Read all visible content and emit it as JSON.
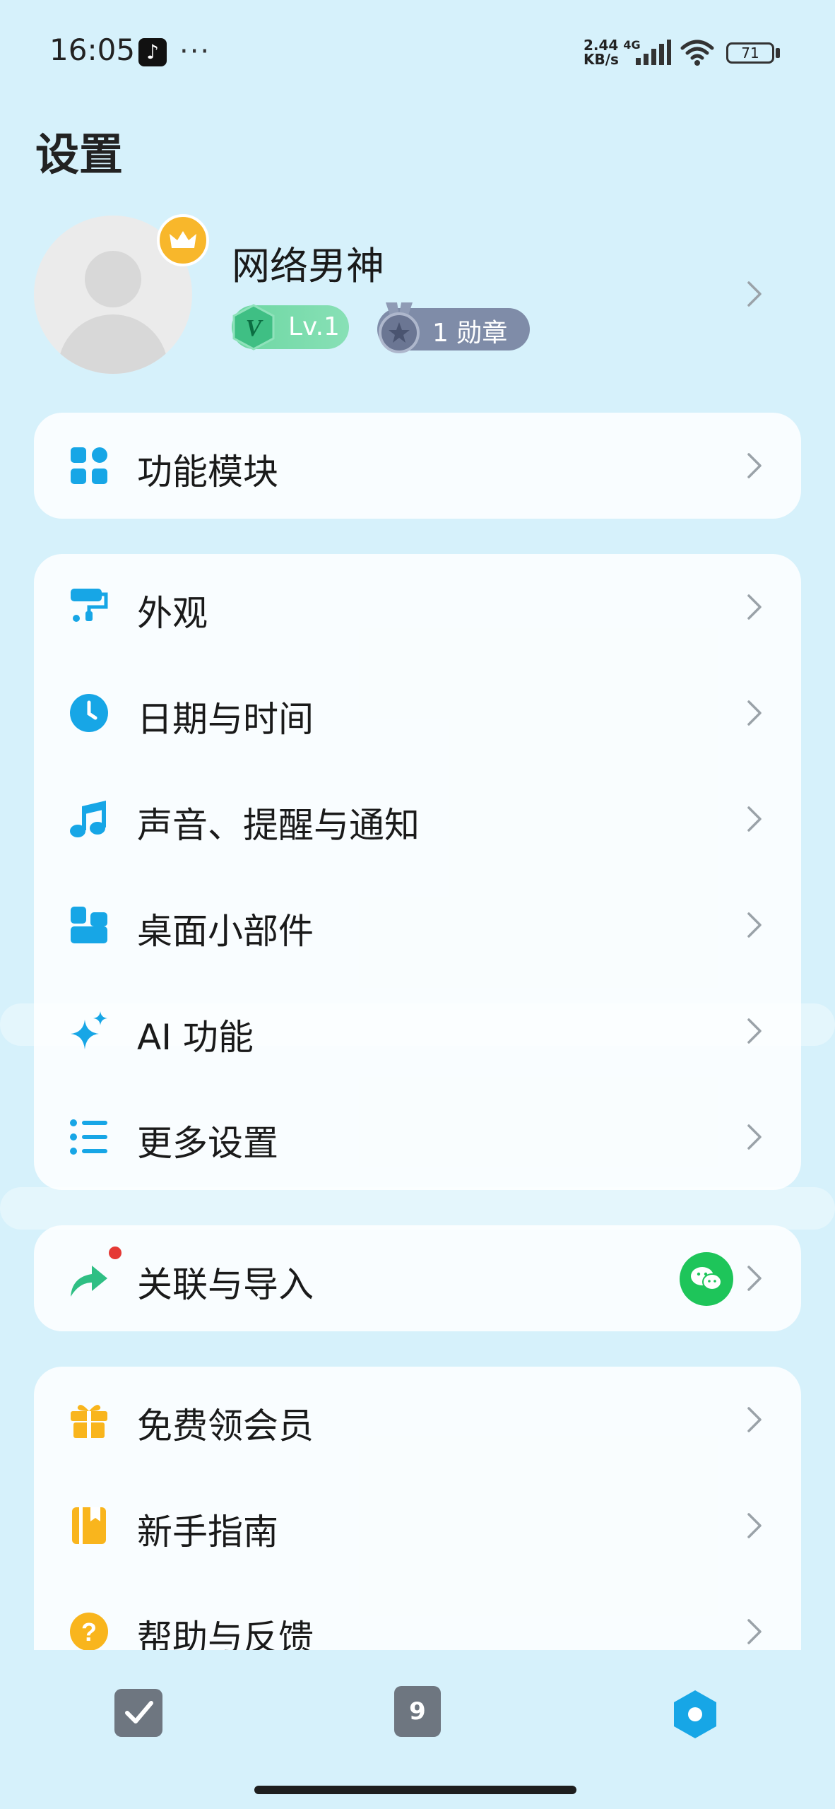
{
  "status_bar": {
    "time": "16:05",
    "more": "···",
    "speed_value": "2.44",
    "speed_unit": "KB/s",
    "network": "4G",
    "battery": "71"
  },
  "page": {
    "title": "设置"
  },
  "profile": {
    "name": "网络男神",
    "level": "Lv.1",
    "medals": "1 勋章"
  },
  "card_modules": {
    "items": [
      {
        "label": "功能模块",
        "icon": "grid-icon"
      }
    ]
  },
  "card_settings": {
    "items": [
      {
        "label": "外观",
        "icon": "paint-roller-icon"
      },
      {
        "label": "日期与时间",
        "icon": "clock-icon"
      },
      {
        "label": "声音、提醒与通知",
        "icon": "music-note-icon"
      },
      {
        "label": "桌面小部件",
        "icon": "widgets-icon"
      },
      {
        "label": "AI 功能",
        "icon": "sparkle-icon"
      },
      {
        "label": "更多设置",
        "icon": "list-settings-icon"
      }
    ]
  },
  "card_link": {
    "items": [
      {
        "label": "关联与导入",
        "icon": "share-arrow-icon"
      }
    ]
  },
  "card_help": {
    "items": [
      {
        "label": "免费领会员",
        "icon": "gift-icon"
      },
      {
        "label": "新手指南",
        "icon": "book-icon"
      },
      {
        "label": "帮助与反馈",
        "icon": "question-icon"
      }
    ]
  },
  "bottom_nav": {
    "calendar_day": "9"
  },
  "colors": {
    "accent_blue": "#17a6e6",
    "accent_orange": "#f9b51d",
    "accent_green": "#1ec55a",
    "background": "#d6f1fb"
  }
}
